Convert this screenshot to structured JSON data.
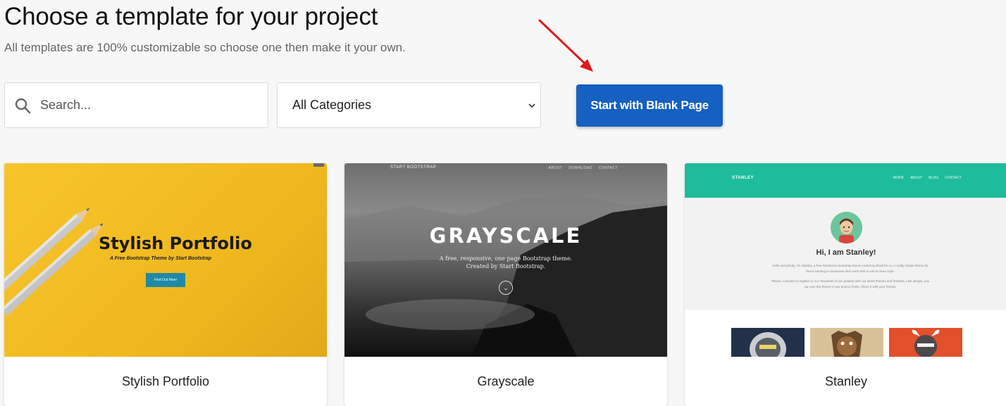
{
  "header": {
    "title": "Choose a template for your project",
    "subtitle": "All templates are 100% customizable so choose one then make it your own."
  },
  "search": {
    "placeholder": "Search...",
    "value": ""
  },
  "category_select": {
    "selected": "All Categories"
  },
  "blank_button": {
    "label": "Start with Blank Page"
  },
  "colors": {
    "primary": "#1560c0",
    "annotation_arrow": "#e01b1b"
  },
  "templates": [
    {
      "name": "Stylish Portfolio",
      "preview": {
        "headline": "Stylish Portfolio",
        "tagline": "A Free Bootstrap Theme by Start Bootstrap",
        "button": "Find Out More"
      }
    },
    {
      "name": "Grayscale",
      "preview": {
        "brand": "START BOOTSTRAP",
        "nav": [
          "ABOUT",
          "DOWNLOAD",
          "CONTACT"
        ],
        "headline": "GRAYSCALE",
        "description_line1": "A free, responsive, one page Bootstrap theme.",
        "description_line2": "Created by Start Bootstrap."
      }
    },
    {
      "name": "Stanley",
      "preview": {
        "logo": "STANLEY",
        "nav": [
          "WORK",
          "ABOUT",
          "BLOG",
          "CONTACT"
        ],
        "greeting": "Hi, I am Stanley!",
        "paragraph1": "Hello everybody. I'm Stanley, a free handsome bootstrap theme coded by BlackTie.co. A really simple theme for those wanting to showcase their work with a cute & clean style.",
        "paragraph2": "Please, consider to register to our newsletter to be updated with our latest themes and freebies. Like always, you can use this theme in any project freely. Share it with your friends."
      }
    }
  ]
}
